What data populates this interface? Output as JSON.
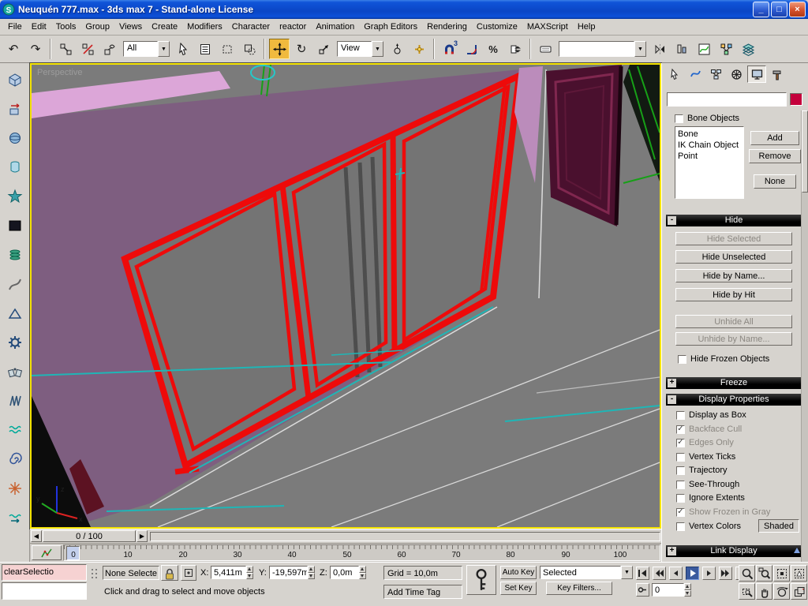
{
  "window": {
    "title": "Neuquén 777.max - 3ds max 7  - Stand-alone License"
  },
  "glyphs": {
    "minimize": "_",
    "maximize": "□",
    "close": "×",
    "undo": "↶",
    "redo": "↷",
    "rotate": "↻",
    "dropdown": "▼",
    "left": "◀",
    "right": "▶",
    "check": "✓",
    "percent": "%"
  },
  "menu": {
    "items": [
      "File",
      "Edit",
      "Tools",
      "Group",
      "Views",
      "Create",
      "Modifiers",
      "Character",
      "reactor",
      "Animation",
      "Graph Editors",
      "Rendering",
      "Customize",
      "MAXScript",
      "Help"
    ]
  },
  "toolbar": {
    "selection_filter": "All",
    "ref_coord": "View",
    "snap_level": "3",
    "named_selection": ""
  },
  "viewport": {
    "label": "Perspective"
  },
  "time_slider": {
    "label": "0 / 100"
  },
  "track_bar": {
    "ticks": [
      "0",
      "10",
      "20",
      "30",
      "40",
      "50",
      "60",
      "70",
      "80",
      "90",
      "100"
    ]
  },
  "command_panel": {
    "object_name": "",
    "hide_by_category": {
      "bone_objects_label": "Bone Objects",
      "categories": [
        "Bone",
        "IK Chain Object",
        "Point"
      ],
      "add_label": "Add",
      "remove_label": "Remove",
      "none_label": "None"
    },
    "hide": {
      "title": "Hide",
      "state": "-",
      "hide_selected": "Hide Selected",
      "hide_unselected": "Hide Unselected",
      "hide_by_name": "Hide by Name...",
      "hide_by_hit": "Hide by Hit",
      "unhide_all": "Unhide All",
      "unhide_by_name": "Unhide by Name...",
      "hide_frozen": "Hide Frozen Objects"
    },
    "freeze": {
      "title": "Freeze",
      "state": "+"
    },
    "display_properties": {
      "title": "Display Properties",
      "state": "-",
      "checkboxes": [
        {
          "label": "Display as Box",
          "checked": false
        },
        {
          "label": "Backface Cull",
          "checked": true
        },
        {
          "label": "Edges Only",
          "checked": true
        },
        {
          "label": "Vertex Ticks",
          "checked": false
        },
        {
          "label": "Trajectory",
          "checked": false
        },
        {
          "label": "See-Through",
          "checked": false
        },
        {
          "label": "Ignore Extents",
          "checked": false
        },
        {
          "label": "Show Frozen in Gray",
          "checked": true
        },
        {
          "label": "Vertex Colors",
          "checked": false
        }
      ],
      "shaded_label": "Shaded"
    },
    "link_display": {
      "title": "Link Display",
      "state": "+"
    }
  },
  "status_bar": {
    "listener_top": "clearSelectio",
    "listener_bottom": "",
    "selection_status": "None Selecte",
    "x_label": "X:",
    "x_value": "5,411m",
    "y_label": "Y:",
    "y_value": "-19,597m",
    "z_label": "Z:",
    "z_value": "0,0m",
    "grid": "Grid = 10,0m",
    "prompt": "Click and drag to select and move objects",
    "add_time_tag": "Add Time Tag",
    "auto_key": "Auto Key",
    "set_key": "Set Key",
    "key_filter_scope": "Selected",
    "key_filters": "Key Filters...",
    "frame_field": "0"
  },
  "colors": {
    "selection_red": "#ee0a0a",
    "wall_purple": "#7e5e80",
    "active_viewport_border": "#f5e400",
    "object_color_swatch": "#c4003c"
  }
}
